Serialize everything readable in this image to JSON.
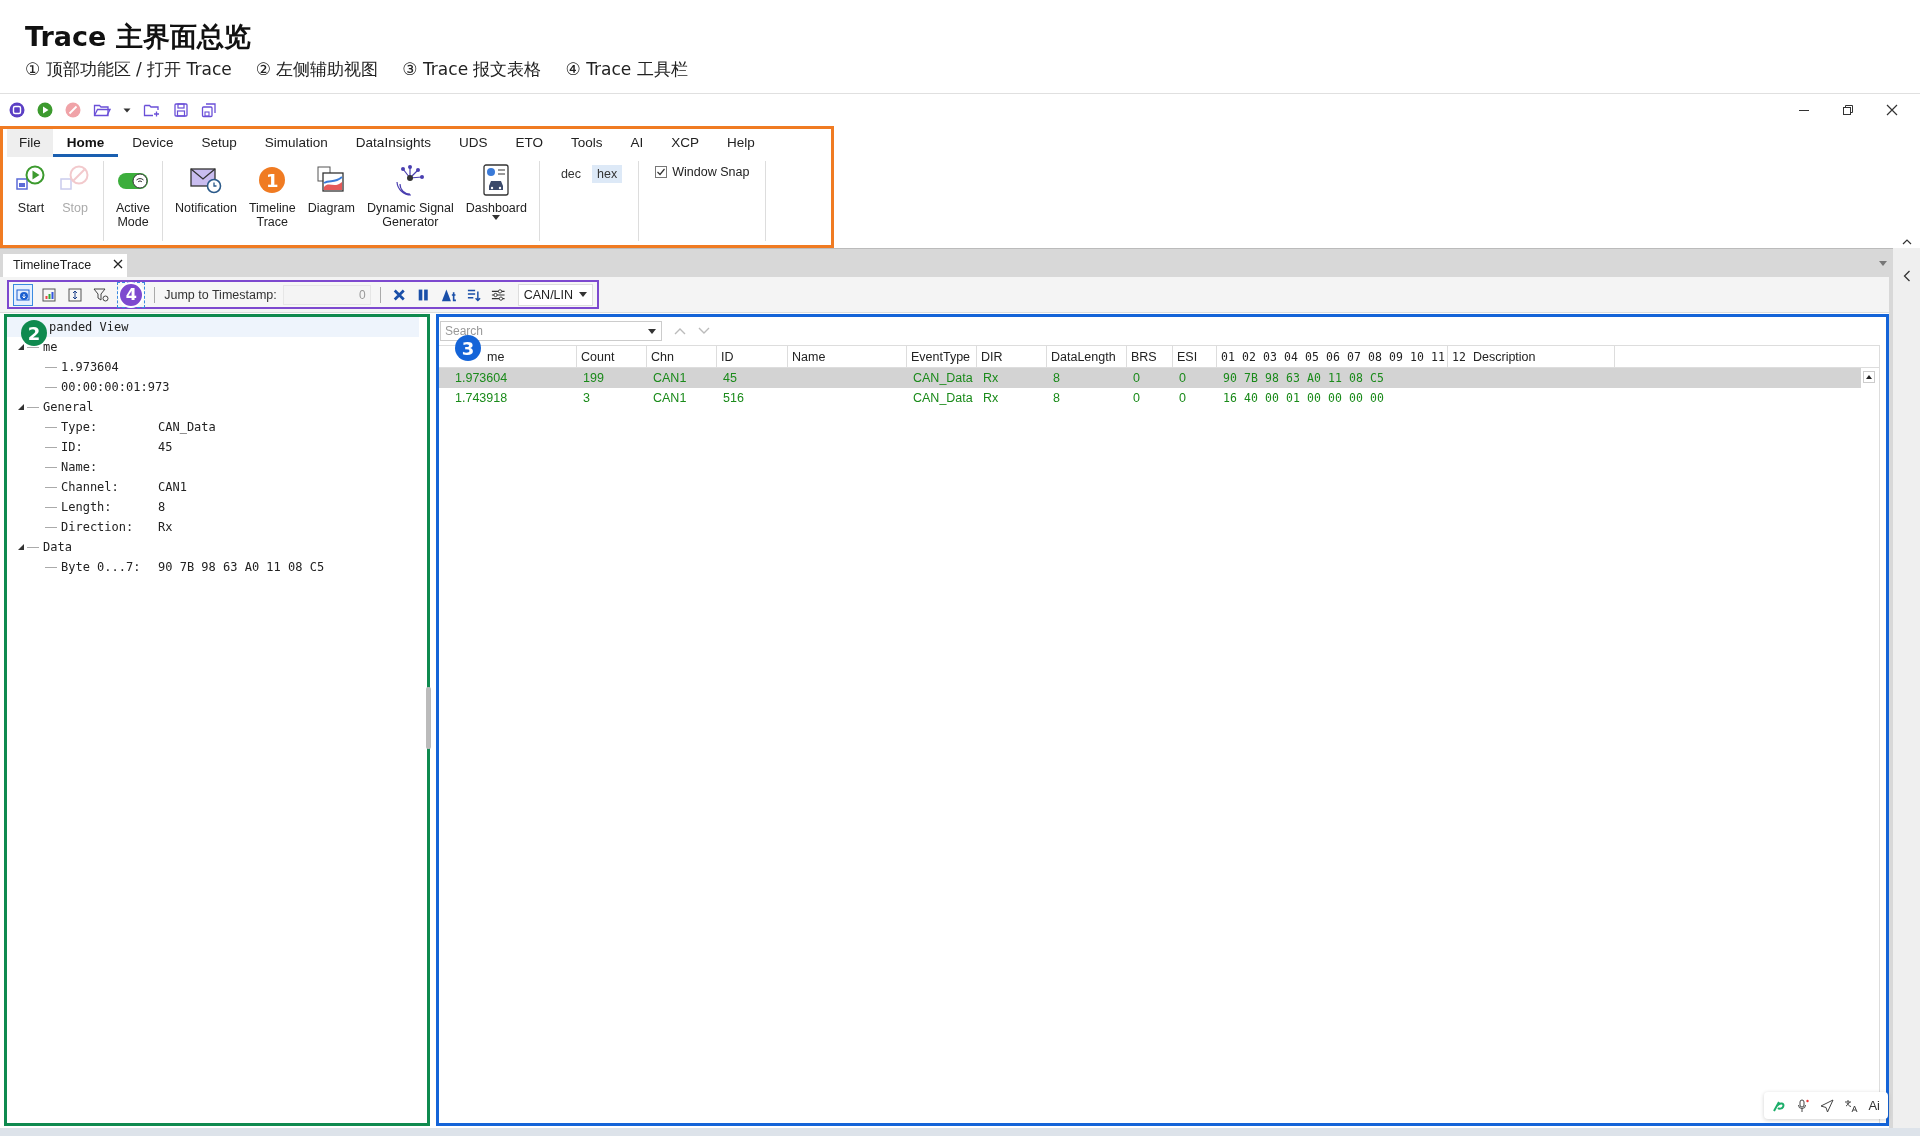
{
  "header": {
    "title": "Trace 主界面总览",
    "legend": [
      "① 顶部功能区 / 打开 Trace",
      "② 左侧辅助视图",
      "③ Trace 报文表格",
      "④ Trace 工具栏"
    ]
  },
  "ribbon": {
    "callout": {
      "label": "1",
      "color": "#f07b22"
    },
    "tabs": [
      {
        "label": "File",
        "kind": "file",
        "selected": false
      },
      {
        "label": "Home",
        "kind": "tab",
        "selected": true
      },
      {
        "label": "Device",
        "kind": "tab",
        "selected": false
      },
      {
        "label": "Setup",
        "kind": "tab",
        "selected": false
      },
      {
        "label": "Simulation",
        "kind": "tab",
        "selected": false
      },
      {
        "label": "DataInsights",
        "kind": "tab",
        "selected": false
      },
      {
        "label": "UDS",
        "kind": "tab",
        "selected": false
      },
      {
        "label": "ETO",
        "kind": "tab",
        "selected": false
      },
      {
        "label": "Tools",
        "kind": "tab",
        "selected": false
      },
      {
        "label": "AI",
        "kind": "tab",
        "selected": false
      },
      {
        "label": "XCP",
        "kind": "tab",
        "selected": false
      },
      {
        "label": "Help",
        "kind": "tab",
        "selected": false
      }
    ],
    "groups": [
      {
        "kind": "buttons",
        "buttons": [
          {
            "label": "Start",
            "disabled": false,
            "dropdown": false,
            "callout": false
          },
          {
            "label": "Stop",
            "disabled": true,
            "dropdown": false,
            "callout": false
          }
        ]
      },
      {
        "kind": "buttons",
        "buttons": [
          {
            "label": "Active\nMode",
            "disabled": false,
            "dropdown": false,
            "callout": false
          }
        ]
      },
      {
        "kind": "buttons",
        "buttons": [
          {
            "label": "Notification",
            "disabled": false,
            "dropdown": false,
            "callout": false
          },
          {
            "label": "Timeline\nTrace",
            "disabled": false,
            "dropdown": false,
            "callout": true
          },
          {
            "label": "Diagram",
            "disabled": false,
            "dropdown": false,
            "callout": false
          },
          {
            "label": "Dynamic Signal\nGenerator",
            "disabled": false,
            "dropdown": false,
            "callout": false
          },
          {
            "label": "Dashboard",
            "disabled": false,
            "dropdown": true,
            "callout": false
          }
        ]
      },
      {
        "kind": "format",
        "options": [
          {
            "label": "dec",
            "selected": false
          },
          {
            "label": "hex",
            "selected": true
          }
        ]
      },
      {
        "kind": "checkbox",
        "label": "Window Snap",
        "checked": true
      }
    ]
  },
  "document_tab": {
    "title": "TimelineTrace"
  },
  "trace_toolbar": {
    "callout": {
      "label": "4",
      "color": "#7d49cf"
    },
    "view_buttons": [
      {
        "selected": true
      },
      {
        "selected": false
      },
      {
        "selected": false
      },
      {
        "selected": false
      }
    ],
    "jump_label": "Jump to Timestamp:",
    "timestamp": "0",
    "protocol": "CAN/LIN"
  },
  "tree": {
    "callout": {
      "label": "2",
      "color": "#0f8a4f"
    },
    "title": "panded View",
    "nodes": [
      {
        "label": "me",
        "expanded": true,
        "children": [
          {
            "label": "1.973604"
          },
          {
            "label": "00:00:00:01:973"
          }
        ]
      },
      {
        "label": "General",
        "expanded": true,
        "children": [
          {
            "label": "Type:",
            "value": "CAN_Data"
          },
          {
            "label": "ID:",
            "value": "45"
          },
          {
            "label": "Name:"
          },
          {
            "label": "Channel:",
            "value": "CAN1"
          },
          {
            "label": "Length:",
            "value": "8"
          },
          {
            "label": "Direction:",
            "value": "Rx"
          }
        ]
      },
      {
        "label": "Data",
        "expanded": true,
        "children": [
          {
            "label": "Byte 0...7:",
            "value": "90 7B 98 63 A0 11 08 C5"
          }
        ]
      }
    ]
  },
  "table": {
    "callout": {
      "label": "3",
      "color": "#1464d8"
    },
    "search_placeholder": "Search",
    "columns": [
      "me",
      "Count",
      "Chn",
      "ID",
      "Name",
      "EventType",
      "DIR",
      "DataLength",
      "BRS",
      "ESI",
      "01",
      "02",
      "03",
      "04",
      "05",
      "06",
      "07",
      "08",
      "09",
      "10",
      "11",
      "12",
      "Description"
    ],
    "rows": [
      {
        "selected": true,
        "time": "1.973604",
        "count": "199",
        "chn": "CAN1",
        "id": "45",
        "event_type": "CAN_Data",
        "dir": "Rx",
        "data_length": "8",
        "brs": "0",
        "esi": "0",
        "bytes": [
          "90",
          "7B",
          "98",
          "63",
          "A0",
          "11",
          "08",
          "C5"
        ]
      },
      {
        "selected": false,
        "time": "1.743918",
        "count": "3",
        "chn": "CAN1",
        "id": "516",
        "event_type": "CAN_Data",
        "dir": "Rx",
        "data_length": "8",
        "brs": "0",
        "esi": "0",
        "bytes": [
          "16",
          "40",
          "00",
          "01",
          "00",
          "00",
          "00",
          "00"
        ]
      }
    ]
  },
  "assistant_bar": {
    "label": "Ai"
  }
}
